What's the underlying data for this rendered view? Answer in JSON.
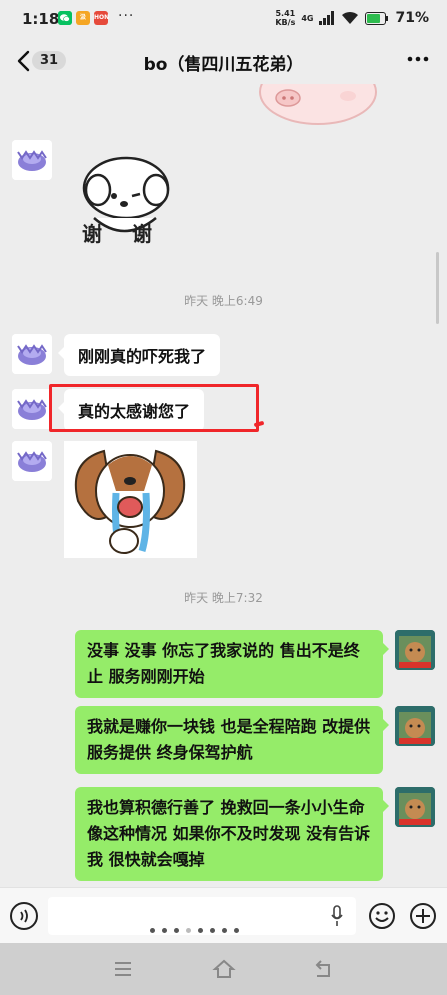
{
  "status_bar": {
    "time": "1:18",
    "apps": [
      {
        "name": "wechat",
        "color": "#07c160",
        "label": ""
      },
      {
        "name": "app-yellow",
        "color": "#f5a623",
        "label": "汲"
      },
      {
        "name": "app-red",
        "color": "#e64a3b",
        "label": "HON"
      }
    ],
    "more": "···",
    "net_speed_value": "5.41",
    "net_speed_unit": "KB/s",
    "network": "4G",
    "battery": "71%"
  },
  "header": {
    "unread_count": "31",
    "title": "bo（售四川五花弟）"
  },
  "messages": [
    {
      "type": "timestamp",
      "text": "昨天 晚上6:49"
    },
    {
      "type": "text",
      "side": "left",
      "text": "刚刚真的吓死我了"
    },
    {
      "type": "text",
      "side": "left",
      "text": "真的太感谢您了"
    },
    {
      "type": "timestamp",
      "text": "昨天 晚上7:32"
    },
    {
      "type": "text",
      "side": "right",
      "text": "没事 没事  你忘了我家说的  售出不是终止 服务刚刚开始"
    },
    {
      "type": "text",
      "side": "right",
      "text": "我就是赚你一块钱 也是全程陪跑  改提供服务提供  终身保驾护航"
    },
    {
      "type": "text",
      "side": "right",
      "text": "我也算积德行善了 挽救回一条小小生命  像这种情况 如果你不及时发现  没有告诉我  很快就会嘎掉"
    }
  ],
  "stickers": {
    "thanks_text": "谢谢"
  },
  "colors": {
    "bubble_self": "#95ec69",
    "bubble_other": "#ffffff",
    "background": "#ededed",
    "highlight": "#f0262a"
  }
}
